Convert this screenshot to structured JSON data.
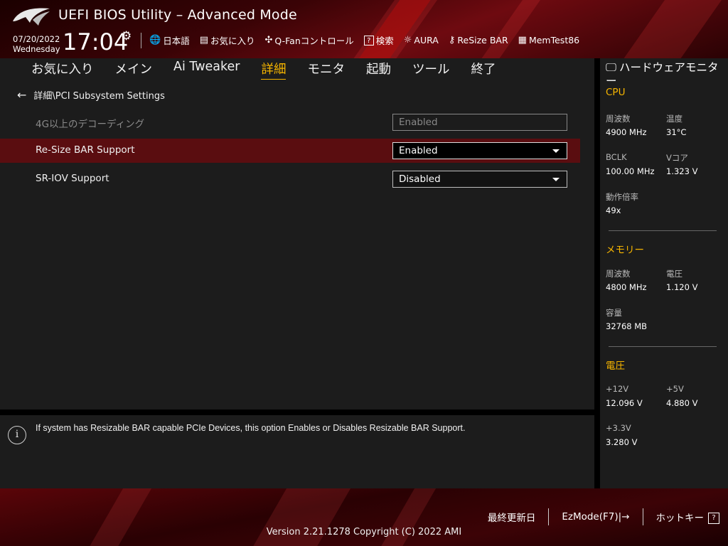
{
  "header": {
    "title": "UEFI BIOS Utility – Advanced Mode",
    "date": "07/20/2022",
    "weekday": "Wednesday",
    "time": "17:04",
    "toolbar": [
      {
        "name": "language",
        "icon": "globe-icon",
        "glyph": "🌐",
        "label": "日本語"
      },
      {
        "name": "favorites",
        "icon": "favorites-icon",
        "glyph": "▤",
        "label": "お気に入り"
      },
      {
        "name": "qfan",
        "icon": "fan-icon",
        "glyph": "✣",
        "label": "Q-Fanコントロール"
      },
      {
        "name": "search",
        "icon": "search-icon",
        "glyph": "?",
        "label": "検索"
      },
      {
        "name": "aura",
        "icon": "aura-icon",
        "glyph": "☼",
        "label": "AURA"
      },
      {
        "name": "resize-bar",
        "icon": "resize-bar-icon",
        "glyph": "⚷",
        "label": "ReSize BAR"
      },
      {
        "name": "memtest",
        "icon": "memory-icon",
        "glyph": "▦",
        "label": "MemTest86"
      }
    ]
  },
  "nav": {
    "tabs": [
      {
        "label": "お気に入り",
        "active": false
      },
      {
        "label": "メイン",
        "active": false
      },
      {
        "label": "Ai Tweaker",
        "active": false
      },
      {
        "label": "詳細",
        "active": true
      },
      {
        "label": "モニタ",
        "active": false
      },
      {
        "label": "起動",
        "active": false
      },
      {
        "label": "ツール",
        "active": false
      },
      {
        "label": "終了",
        "active": false
      }
    ]
  },
  "main": {
    "breadcrumb": "詳細\\PCI Subsystem Settings",
    "settings": [
      {
        "label": "4G以上のデコーディング",
        "value": "Enabled",
        "state": "disabled"
      },
      {
        "label": "Re-Size BAR Support",
        "value": "Enabled",
        "state": "selected"
      },
      {
        "label": "SR-IOV Support",
        "value": "Disabled",
        "state": "normal"
      }
    ]
  },
  "help": {
    "text": "If system has Resizable BAR capable PCIe Devices, this option Enables or Disables Resizable BAR Support."
  },
  "hw_monitor": {
    "title": "ハードウェアモニター",
    "cpu": {
      "heading": "CPU",
      "freq_label": "周波数",
      "freq": "4900 MHz",
      "temp_label": "温度",
      "temp": "31°C",
      "bclk_label": "BCLK",
      "bclk": "100.00 MHz",
      "vcore_label": "Vコア",
      "vcore": "1.323 V",
      "ratio_label": "動作倍率",
      "ratio": "49x"
    },
    "memory": {
      "heading": "メモリー",
      "freq_label": "周波数",
      "freq": "4800 MHz",
      "volt_label": "電圧",
      "volt": "1.120 V",
      "cap_label": "容量",
      "cap": "32768 MB"
    },
    "voltage": {
      "heading": "電圧",
      "v12_label": "+12V",
      "v12": "12.096 V",
      "v5_label": "+5V",
      "v5": "4.880 V",
      "v33_label": "+3.3V",
      "v33": "3.280 V"
    }
  },
  "footer": {
    "last_modified": "最終更新日",
    "ezmode": "EzMode(F7)|",
    "hotkeys": "ホットキー",
    "hotkey_glyph": "?",
    "version": "Version 2.21.1278 Copyright (C) 2022 AMI"
  },
  "colors": {
    "accent": "#f5b400",
    "highlight_row": "#5a0d10",
    "panel": "#1c1c1c"
  }
}
